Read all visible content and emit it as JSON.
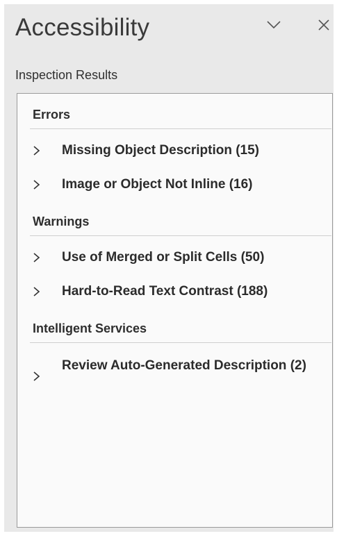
{
  "pane": {
    "title": "Accessibility",
    "subtitle": "Inspection Results"
  },
  "icons": {
    "collapse": "chevron-down-icon",
    "close": "close-icon",
    "expand": "chevron-right-icon"
  },
  "groups": [
    {
      "header": "Errors",
      "items": [
        {
          "label": "Missing Object Description (15)"
        },
        {
          "label": "Image or Object Not Inline (16)"
        }
      ]
    },
    {
      "header": "Warnings",
      "items": [
        {
          "label": "Use of Merged or Split Cells (50)"
        },
        {
          "label": "Hard-to-Read Text Contrast (188)"
        }
      ]
    },
    {
      "header": "Intelligent Services",
      "items": [
        {
          "label": "Review Auto-Generated Description (2)"
        }
      ]
    }
  ]
}
